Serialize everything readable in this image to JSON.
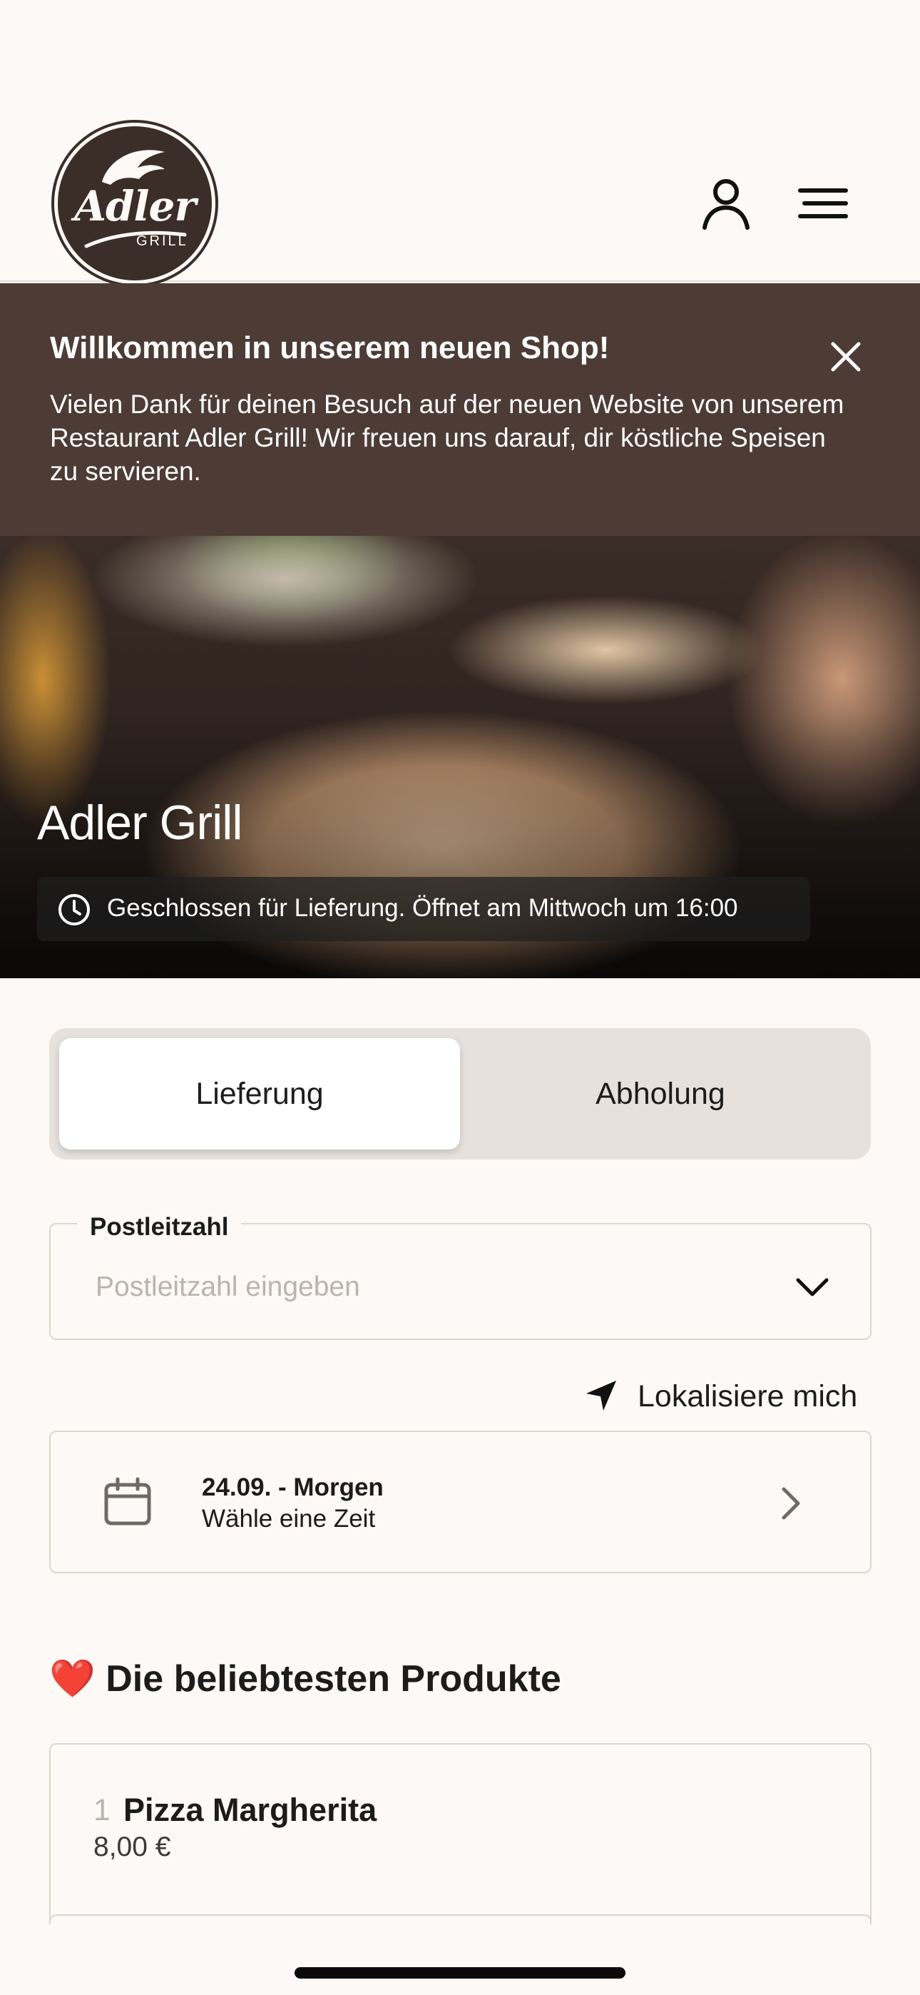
{
  "header": {
    "logo_text": "Adler",
    "logo_subtext": "GRILL"
  },
  "banner": {
    "title": "Willkommen in unserem neuen Shop!",
    "text": "Vielen Dank für deinen Besuch auf der neuen Website von unserem Restaurant Adler Grill! Wir freuen uns darauf, dir köstliche Speisen zu servieren."
  },
  "hero": {
    "restaurant_name": "Adler Grill",
    "status": "Geschlossen für Lieferung. Öffnet am Mittwoch um 16:00"
  },
  "order_mode": {
    "options": [
      "Lieferung",
      "Abholung"
    ],
    "selected": "Lieferung"
  },
  "postal": {
    "label": "Postleitzahl",
    "placeholder": "Postleitzahl eingeben"
  },
  "locate": {
    "label": "Lokalisiere mich"
  },
  "schedule": {
    "date": "24.09. - Morgen",
    "hint": "Wähle eine Zeit"
  },
  "popular": {
    "icon": "❤️",
    "title": "Die beliebtesten Produkte",
    "products": [
      {
        "rank": "1",
        "name": "Pizza Margherita",
        "price": "8,00 €"
      }
    ]
  },
  "colors": {
    "background": "#fdf9f6",
    "banner": "#4c3c35",
    "logo": "#3b2e29",
    "border": "#dcd6d1",
    "heart": "#e0242f"
  }
}
